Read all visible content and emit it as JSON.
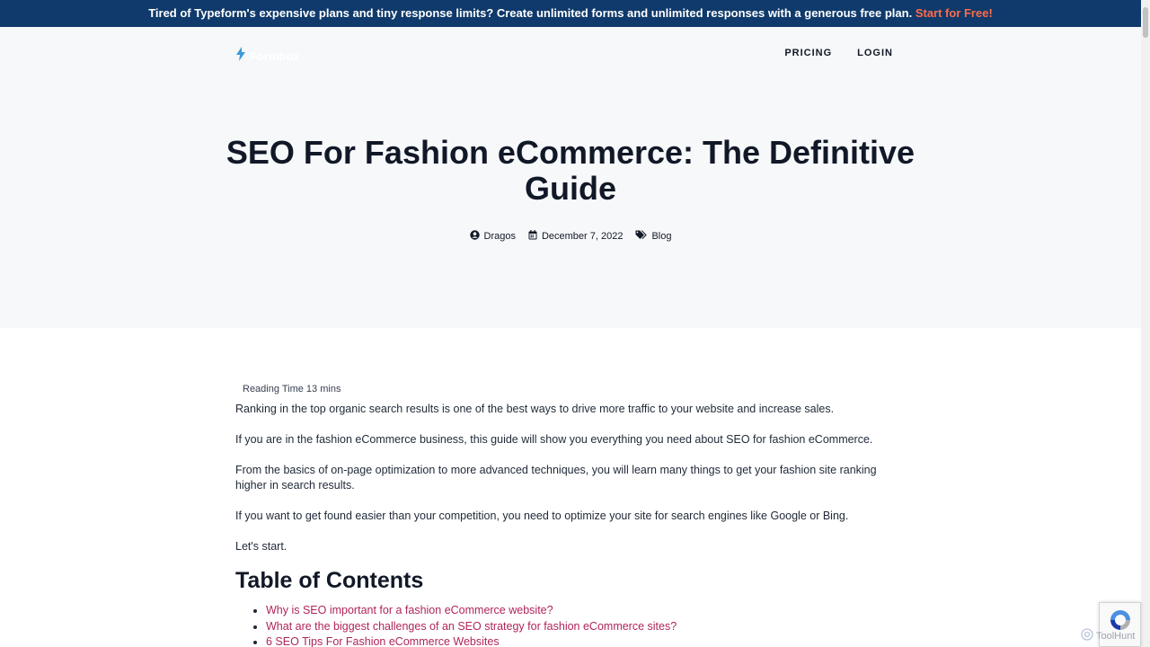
{
  "promo": {
    "text": "Tired of Typeform's expensive plans and tiny response limits? Create unlimited forms and unlimited responses with a generous free plan.",
    "cta": "Start for Free!"
  },
  "header": {
    "logo_text": "Formbox",
    "nav": [
      "PRICING",
      "LOGIN"
    ]
  },
  "article": {
    "title": "SEO For Fashion eCommerce: The Definitive Guide",
    "author": "Dragos",
    "date": "December 7, 2022",
    "category": "Blog",
    "reading_time": "Reading Time 13 mins",
    "paragraphs": [
      "Ranking in the top organic search results is one of the best ways to drive more traffic to your website and increase sales.",
      "If you are in the fashion eCommerce business, this guide will show you everything you need about SEO for fashion eCommerce.",
      "From the basics of on-page optimization to more advanced techniques, you will learn many things to get your fashion site ranking higher in search results.",
      "If you want to get found easier than your competition, you need to optimize your site for search engines like Google or Bing.",
      "Let's start."
    ],
    "toc_heading": "Table of Contents",
    "toc": [
      "Why is SEO important for a fashion eCommerce website?",
      "What are the biggest challenges of an SEO strategy for fashion eCommerce sites?",
      "6 SEO Tips For Fashion eCommerce Websites"
    ]
  },
  "watermark": "ToolHunt",
  "colors": {
    "promo_bg": "#0f3a6b",
    "cta": "#ff6b4a",
    "link": "#b0245b",
    "hero_bg": "#f7f8fa",
    "logo_bolt": "#3b9bd9"
  },
  "icons": [
    "bolt-icon",
    "user-icon",
    "calendar-icon",
    "tags-icon",
    "recaptcha-icon"
  ]
}
